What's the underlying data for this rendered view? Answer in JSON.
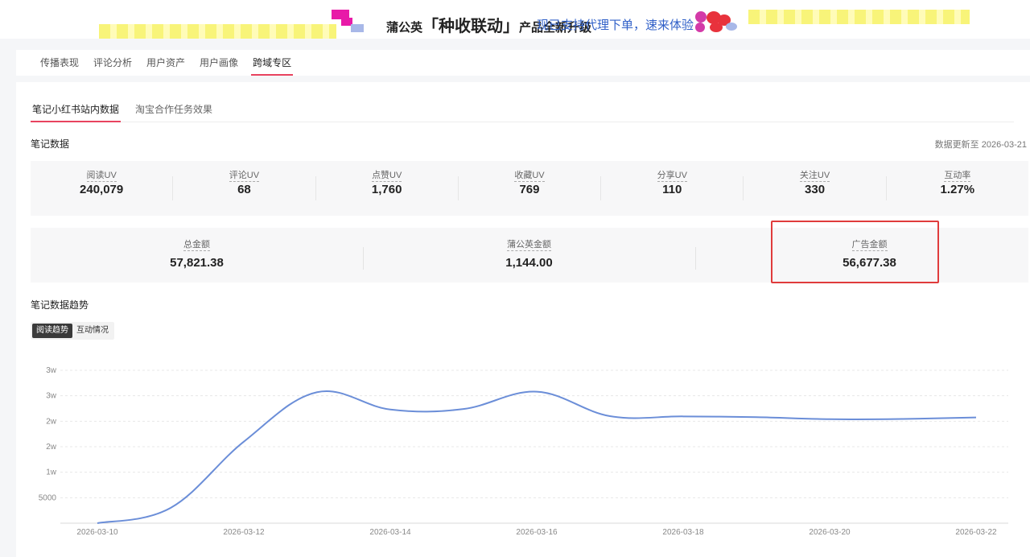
{
  "banner": {
    "brand": "蒲公英",
    "slogan": "「种收联动」",
    "suffix": "产品全新升级",
    "cta": "现已支持代理下单，速来体验"
  },
  "main_tabs": [
    "传播表现",
    "评论分析",
    "用户资产",
    "用户画像",
    "跨域专区"
  ],
  "main_tab_active": "跨域专区",
  "sub_tabs": [
    "笔记小红书站内数据",
    "淘宝合作任务效果"
  ],
  "sub_tab_active": "笔记小红书站内数据",
  "section_note_data": "笔记数据",
  "update_text": "数据更新至 2026-03-21",
  "stats": [
    {
      "label": "阅读UV",
      "value": "240,079"
    },
    {
      "label": "评论UV",
      "value": "68"
    },
    {
      "label": "点赞UV",
      "value": "1,760"
    },
    {
      "label": "收藏UV",
      "value": "769"
    },
    {
      "label": "分享UV",
      "value": "110"
    },
    {
      "label": "关注UV",
      "value": "330"
    },
    {
      "label": "互动率",
      "value": "1.27%"
    }
  ],
  "money": [
    {
      "label": "总金额",
      "value": "57,821.38"
    },
    {
      "label": "蒲公英金额",
      "value": "1,144.00"
    },
    {
      "label": "广告金额",
      "value": "56,677.38"
    }
  ],
  "section_trend": "笔记数据趋势",
  "trend_toggle": [
    "阅读趋势",
    "互动情况"
  ],
  "trend_toggle_active": "阅读趋势",
  "chart_data": {
    "type": "line",
    "y_tick_labels": [
      "5000",
      "1w",
      "2w",
      "2w",
      "3w",
      "3w"
    ],
    "y_tick_values": [
      5000,
      10000,
      15000,
      20000,
      25000,
      30000
    ],
    "ylim": [
      0,
      30000
    ],
    "x_tick_labels": [
      "2026-03-10",
      "2026-03-12",
      "2026-03-14",
      "2026-03-16",
      "2026-03-18",
      "2026-03-20",
      "2026-03-22"
    ],
    "x": [
      "2026-03-10",
      "2026-03-11",
      "2026-03-12",
      "2026-03-13",
      "2026-03-14",
      "2026-03-15",
      "2026-03-16",
      "2026-03-17",
      "2026-03-18",
      "2026-03-19",
      "2026-03-20",
      "2026-03-21",
      "2026-03-22"
    ],
    "series": [
      {
        "values": [
          0,
          3000,
          16000,
          25700,
          22300,
          22400,
          25800,
          21000,
          20950,
          20800,
          20400,
          20450,
          20750
        ],
        "color": "#6b8ed8"
      }
    ],
    "grid": true,
    "legend": "bottom"
  }
}
